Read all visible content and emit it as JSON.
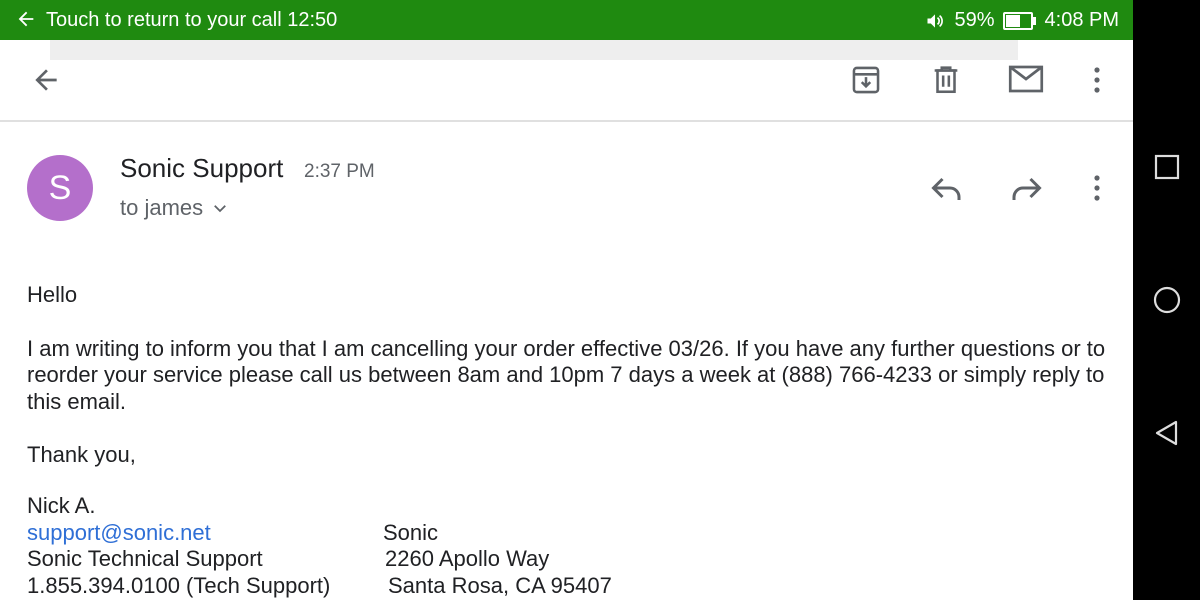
{
  "status_bar": {
    "call_text": "Touch to return to your call 12:50",
    "battery": "59%",
    "battery_level": 0.59,
    "clock": "4:08 PM",
    "color": "#1f8a10"
  },
  "toolbar": {
    "icons": [
      "back-arrow-icon",
      "archive-icon",
      "trash-icon",
      "mail-icon",
      "more-vert-icon"
    ]
  },
  "message": {
    "avatar_letter": "S",
    "avatar_color": "#b46fcb",
    "sender": "Sonic Support",
    "time": "2:37 PM",
    "to": "to james",
    "greeting": "Hello",
    "paragraph": "I am writing to inform you that I am cancelling your order effective 03/26.  If you have any further questions or to reorder your service please call us between 8am and 10pm 7 days a week at (888) 766-4233 or simply reply to this email.",
    "closing": "Thank you,",
    "signature": {
      "name": "Nick A.",
      "left": [
        "support@sonic.net",
        "Sonic Technical Support",
        "1.855.394.0100 (Tech Support)"
      ],
      "right": [
        "Sonic",
        "2260 Apollo Way",
        "Santa Rosa, CA 95407"
      ]
    }
  },
  "nav_bar": {
    "icons": [
      "recents-square-icon",
      "home-circle-icon",
      "back-triangle-icon"
    ]
  }
}
